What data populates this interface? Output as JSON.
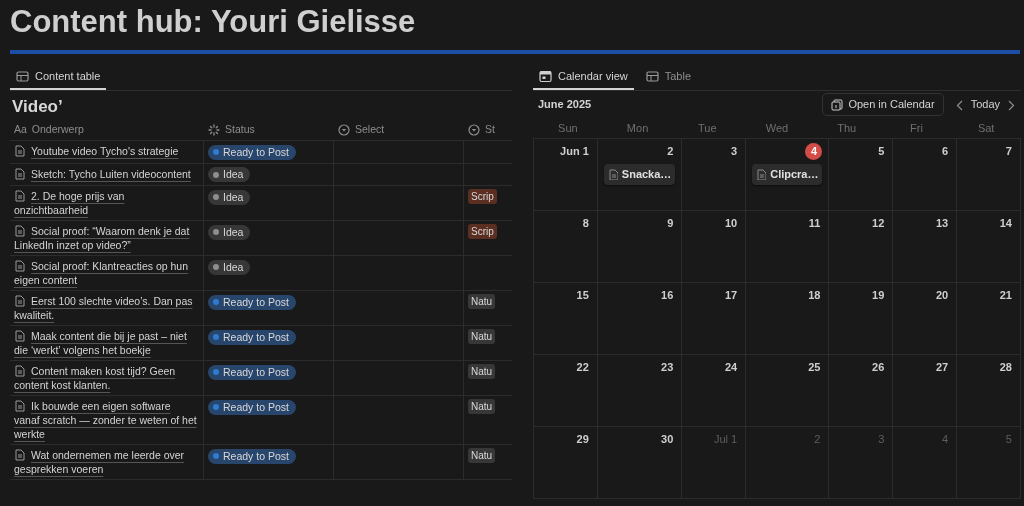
{
  "page_title": "Content hub: Youri Gielisse",
  "left": {
    "tabs": [
      {
        "label": "Content table",
        "selected": true
      }
    ],
    "heading": "Video’",
    "columns": [
      {
        "kind": "title",
        "prefix": "Aa",
        "label": "Onderwerp"
      },
      {
        "kind": "status",
        "label": "Status"
      },
      {
        "kind": "select",
        "label": "Select"
      },
      {
        "kind": "select",
        "label": "St"
      }
    ],
    "rows": [
      {
        "title": "Youtube video Tycho's strategie",
        "status": {
          "label": "Ready to Post",
          "kind": "ready"
        }
      },
      {
        "title": "Sketch: Tycho Luiten videocontent",
        "status": {
          "label": "Idea",
          "kind": "idea"
        }
      },
      {
        "title": "2. De hoge prijs van onzichtbaarheid",
        "status": {
          "label": "Idea",
          "kind": "idea"
        },
        "tag": {
          "label": "Scrip",
          "color": "#5a2e21"
        }
      },
      {
        "title": "Social proof: “Waarom denk je dat LinkedIn inzet op video?”",
        "status": {
          "label": "Idea",
          "kind": "idea"
        },
        "tag": {
          "label": "Scrip",
          "color": "#5a2e21"
        }
      },
      {
        "title": "Social proof: Klantreacties op hun eigen content",
        "status": {
          "label": "Idea",
          "kind": "idea"
        }
      },
      {
        "title": "Eerst 100 slechte video’s. Dan pas kwaliteit.",
        "status": {
          "label": "Ready to Post",
          "kind": "ready"
        },
        "tag": {
          "label": "Natu",
          "color": "#373737"
        }
      },
      {
        "title": "Maak content die bij je past – niet die ‘werkt’ volgens het boekje",
        "status": {
          "label": "Ready to Post",
          "kind": "ready"
        },
        "tag": {
          "label": "Natu",
          "color": "#373737"
        }
      },
      {
        "title": "Content maken kost tijd? Geen content kost klanten.",
        "status": {
          "label": "Ready to Post",
          "kind": "ready"
        },
        "tag": {
          "label": "Natu",
          "color": "#373737"
        }
      },
      {
        "title": "Ik bouwde een eigen software vanaf scratch — zonder te weten of het werkte",
        "status": {
          "label": "Ready to Post",
          "kind": "ready"
        },
        "tag": {
          "label": "Natu",
          "color": "#373737"
        }
      },
      {
        "title": "Wat ondernemen me leerde over gesprekken voeren",
        "status": {
          "label": "Ready to Post",
          "kind": "ready"
        },
        "tag": {
          "label": "Natu",
          "color": "#373737"
        }
      }
    ]
  },
  "right": {
    "tabs": [
      {
        "label": "Calendar view",
        "kind": "calendar",
        "selected": true
      },
      {
        "label": "Table",
        "kind": "table",
        "selected": false
      }
    ],
    "month": "June 2025",
    "open_button": "Open in Calendar",
    "today_button": "Today",
    "weekdays": [
      "Sun",
      "Mon",
      "Tue",
      "Wed",
      "Thu",
      "Fri",
      "Sat"
    ],
    "weeks": [
      [
        {
          "label": "Jun 1",
          "outside_month": false,
          "today": false
        },
        {
          "label": "2",
          "outside_month": false,
          "today": false,
          "events": [
            "Snacka…"
          ]
        },
        {
          "label": "3",
          "outside_month": false,
          "today": false
        },
        {
          "label": "4",
          "outside_month": false,
          "today": true,
          "events": [
            "Clipcra…"
          ]
        },
        {
          "label": "5",
          "outside_month": false,
          "today": false
        },
        {
          "label": "6",
          "outside_month": false,
          "today": false
        },
        {
          "label": "7",
          "outside_month": false,
          "today": false
        }
      ],
      [
        {
          "label": "8",
          "outside_month": false,
          "today": false
        },
        {
          "label": "9",
          "outside_month": false,
          "today": false
        },
        {
          "label": "10",
          "outside_month": false,
          "today": false
        },
        {
          "label": "11",
          "outside_month": false,
          "today": false
        },
        {
          "label": "12",
          "outside_month": false,
          "today": false
        },
        {
          "label": "13",
          "outside_month": false,
          "today": false
        },
        {
          "label": "14",
          "outside_month": false,
          "today": false
        }
      ],
      [
        {
          "label": "15",
          "outside_month": false,
          "today": false
        },
        {
          "label": "16",
          "outside_month": false,
          "today": false
        },
        {
          "label": "17",
          "outside_month": false,
          "today": false
        },
        {
          "label": "18",
          "outside_month": false,
          "today": false
        },
        {
          "label": "19",
          "outside_month": false,
          "today": false
        },
        {
          "label": "20",
          "outside_month": false,
          "today": false
        },
        {
          "label": "21",
          "outside_month": false,
          "today": false
        }
      ],
      [
        {
          "label": "22",
          "outside_month": false,
          "today": false
        },
        {
          "label": "23",
          "outside_month": false,
          "today": false
        },
        {
          "label": "24",
          "outside_month": false,
          "today": false
        },
        {
          "label": "25",
          "outside_month": false,
          "today": false
        },
        {
          "label": "26",
          "outside_month": false,
          "today": false
        },
        {
          "label": "27",
          "outside_month": false,
          "today": false
        },
        {
          "label": "28",
          "outside_month": false,
          "today": false
        }
      ],
      [
        {
          "label": "29",
          "outside_month": false,
          "today": false
        },
        {
          "label": "30",
          "outside_month": false,
          "today": false
        },
        {
          "label": "Jul 1",
          "outside_month": true,
          "today": false
        },
        {
          "label": "2",
          "outside_month": true,
          "today": false
        },
        {
          "label": "3",
          "outside_month": true,
          "today": false
        },
        {
          "label": "4",
          "outside_month": true,
          "today": false
        },
        {
          "label": "5",
          "outside_month": true,
          "today": false
        }
      ]
    ]
  }
}
